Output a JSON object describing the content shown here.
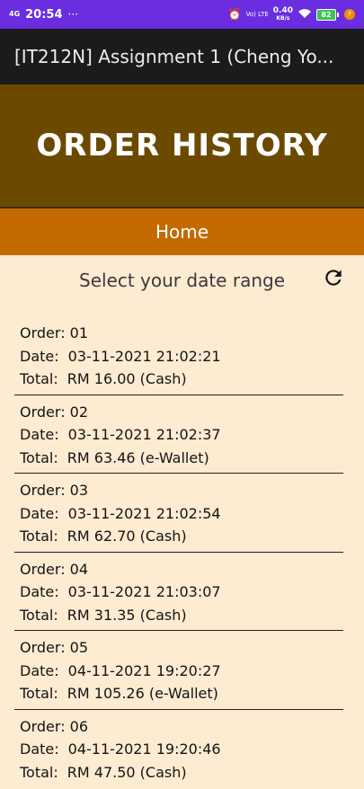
{
  "status_bar": {
    "network": "4G",
    "time": "20:54",
    "dots": "···",
    "volte": "Vo) LTE",
    "speed": "0.40",
    "speed_unit": "KB/s",
    "battery": "82"
  },
  "app_bar": {
    "title": "[IT212N] Assignment 1 (Cheng Yo..."
  },
  "hero": {
    "title": "ORDER HISTORY"
  },
  "nav": {
    "home_label": "Home"
  },
  "date_range": {
    "label": "Select your date range"
  },
  "orders": [
    {
      "order_label": "Order:",
      "order_no": "01",
      "date_label": "Date:",
      "date": "03-11-2021 21:02:21",
      "total_label": "Total:",
      "total": "RM 16.00 (Cash)"
    },
    {
      "order_label": "Order:",
      "order_no": "02",
      "date_label": "Date:",
      "date": "03-11-2021 21:02:37",
      "total_label": "Total:",
      "total": "RM 63.46 (e-Wallet)"
    },
    {
      "order_label": "Order:",
      "order_no": "03",
      "date_label": "Date:",
      "date": "03-11-2021 21:02:54",
      "total_label": "Total:",
      "total": "RM 62.70 (Cash)"
    },
    {
      "order_label": "Order:",
      "order_no": "04",
      "date_label": "Date:",
      "date": "03-11-2021 21:03:07",
      "total_label": "Total:",
      "total": "RM 31.35 (Cash)"
    },
    {
      "order_label": "Order:",
      "order_no": "05",
      "date_label": "Date:",
      "date": "04-11-2021 19:20:27",
      "total_label": "Total:",
      "total": "RM 105.26 (e-Wallet)"
    },
    {
      "order_label": "Order:",
      "order_no": "06",
      "date_label": "Date:",
      "date": "04-11-2021 19:20:46",
      "total_label": "Total:",
      "total": "RM 47.50 (Cash)"
    }
  ],
  "icons": {
    "refresh": "refresh-icon",
    "alarm": "alarm-icon",
    "wifi": "wifi-icon",
    "battery": "battery-icon",
    "charging": "charging-icon"
  },
  "colors": {
    "status_bar": "#6a2ee0",
    "app_bar": "#1b1b1b",
    "hero": "#6b4a00",
    "nav": "#c46a00",
    "background": "#fdebd2"
  }
}
